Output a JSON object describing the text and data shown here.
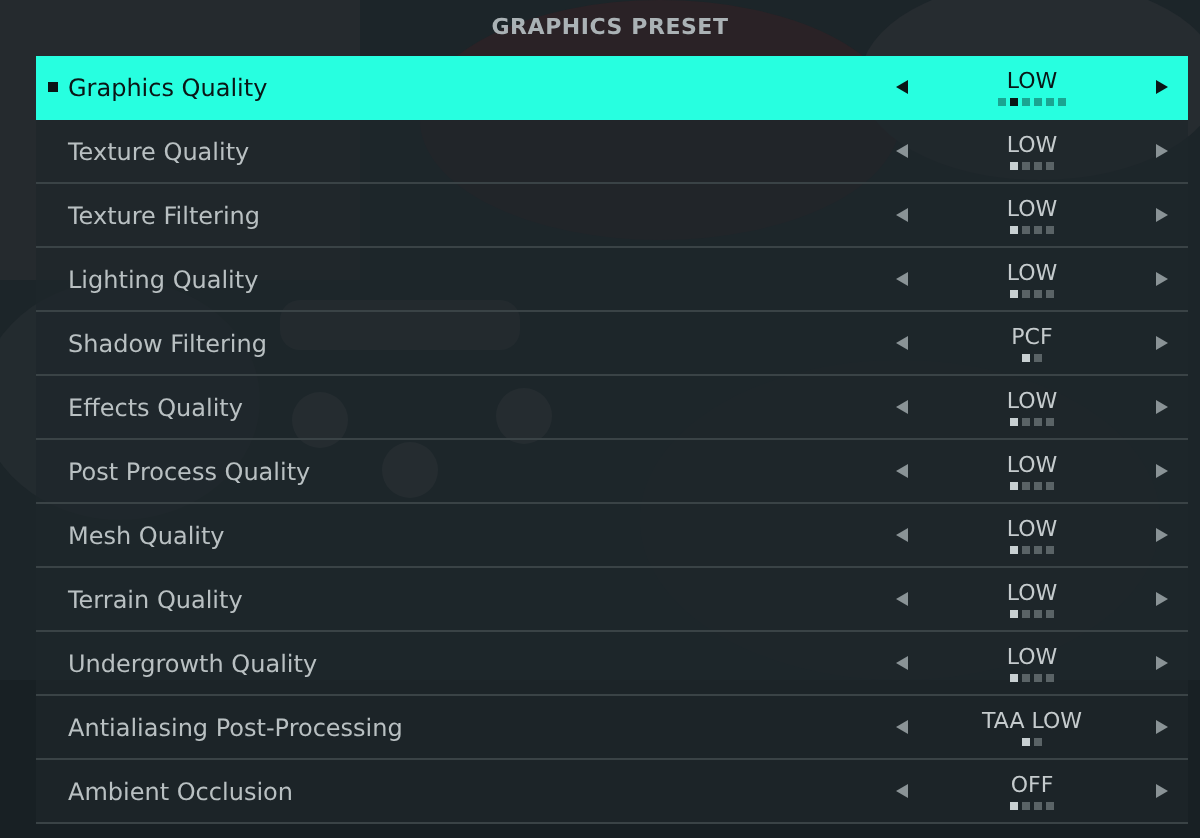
{
  "header": {
    "title": "GRAPHICS PRESET"
  },
  "settings": [
    {
      "label": "Graphics Quality",
      "value": "LOW",
      "selected": true,
      "steps": [
        {
          "selected": false
        },
        {
          "selected": true
        },
        {
          "selected": false
        },
        {
          "selected": false
        },
        {
          "selected": false
        },
        {
          "selected": false
        }
      ]
    },
    {
      "label": "Texture Quality",
      "value": "LOW",
      "selected": false,
      "steps": [
        {
          "selected": true
        },
        {
          "selected": false
        },
        {
          "selected": false
        },
        {
          "selected": false
        }
      ]
    },
    {
      "label": "Texture Filtering",
      "value": "LOW",
      "selected": false,
      "steps": [
        {
          "selected": true
        },
        {
          "selected": false
        },
        {
          "selected": false
        },
        {
          "selected": false
        }
      ]
    },
    {
      "label": "Lighting Quality",
      "value": "LOW",
      "selected": false,
      "steps": [
        {
          "selected": true
        },
        {
          "selected": false
        },
        {
          "selected": false
        },
        {
          "selected": false
        }
      ]
    },
    {
      "label": "Shadow Filtering",
      "value": "PCF",
      "selected": false,
      "steps": [
        {
          "selected": true
        },
        {
          "selected": false
        }
      ]
    },
    {
      "label": "Effects Quality",
      "value": "LOW",
      "selected": false,
      "steps": [
        {
          "selected": true
        },
        {
          "selected": false
        },
        {
          "selected": false
        },
        {
          "selected": false
        }
      ]
    },
    {
      "label": "Post Process Quality",
      "value": "LOW",
      "selected": false,
      "steps": [
        {
          "selected": true
        },
        {
          "selected": false
        },
        {
          "selected": false
        },
        {
          "selected": false
        }
      ]
    },
    {
      "label": "Mesh Quality",
      "value": "LOW",
      "selected": false,
      "steps": [
        {
          "selected": true
        },
        {
          "selected": false
        },
        {
          "selected": false
        },
        {
          "selected": false
        }
      ]
    },
    {
      "label": "Terrain Quality",
      "value": "LOW",
      "selected": false,
      "steps": [
        {
          "selected": true
        },
        {
          "selected": false
        },
        {
          "selected": false
        },
        {
          "selected": false
        }
      ]
    },
    {
      "label": "Undergrowth Quality",
      "value": "LOW",
      "selected": false,
      "steps": [
        {
          "selected": true
        },
        {
          "selected": false
        },
        {
          "selected": false
        },
        {
          "selected": false
        }
      ]
    },
    {
      "label": "Antialiasing Post-Processing",
      "value": "TAA LOW",
      "selected": false,
      "steps": [
        {
          "selected": true
        },
        {
          "selected": false
        }
      ]
    },
    {
      "label": "Ambient Occlusion",
      "value": "OFF",
      "selected": false,
      "steps": [
        {
          "selected": true
        },
        {
          "selected": false
        },
        {
          "selected": false
        },
        {
          "selected": false
        }
      ]
    }
  ]
}
